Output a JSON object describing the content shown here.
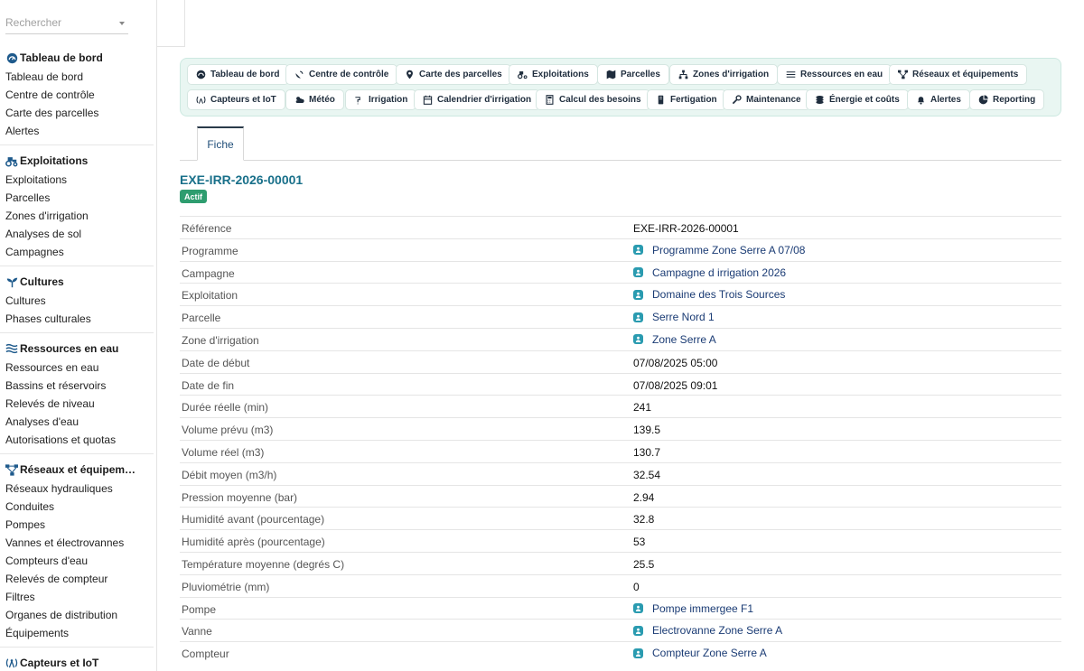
{
  "sidebar": {
    "search_placeholder": "Rechercher",
    "groups": [
      {
        "title": "Tableau de bord",
        "icon": "gauge-icon",
        "items": [
          "Tableau de bord",
          "Centre de contrôle",
          "Carte des parcelles",
          "Alertes"
        ]
      },
      {
        "title": "Exploitations",
        "icon": "tractor-icon",
        "items": [
          "Exploitations",
          "Parcelles",
          "Zones d'irrigation",
          "Analyses de sol",
          "Campagnes"
        ]
      },
      {
        "title": "Cultures",
        "icon": "seedling-icon",
        "items": [
          "Cultures",
          "Phases culturales"
        ]
      },
      {
        "title": "Ressources en eau",
        "icon": "water-icon",
        "items": [
          "Ressources en eau",
          "Bassins et réservoirs",
          "Relevés de niveau",
          "Analyses d'eau",
          "Autorisations et quotas"
        ]
      },
      {
        "title": "Réseaux et équipem…",
        "icon": "network-icon",
        "items": [
          "Réseaux hydrauliques",
          "Conduites",
          "Pompes",
          "Vannes et électrovannes",
          "Compteurs d'eau",
          "Relevés de compteur",
          "Filtres",
          "Organes de distribution",
          "Équipements"
        ]
      },
      {
        "title": "Capteurs et IoT",
        "icon": "antenna-icon",
        "items": []
      }
    ]
  },
  "toolbar": {
    "row1": [
      {
        "label": "Tableau de bord",
        "icon": "gauge-icon"
      },
      {
        "label": "Centre de contrôle",
        "icon": "satellite-dish-icon"
      },
      {
        "label": "Carte des parcelles",
        "icon": "map-marker-icon"
      },
      {
        "label": "Exploitations",
        "icon": "tractor-icon"
      },
      {
        "label": "Parcelles",
        "icon": "map-icon"
      },
      {
        "label": "Zones d'irrigation",
        "icon": "sitemap-icon"
      },
      {
        "label": "Ressources en eau",
        "icon": "water-icon"
      },
      {
        "label": "Réseaux et équipements",
        "icon": "network-icon"
      }
    ],
    "row2": [
      {
        "label": "Capteurs et IoT",
        "icon": "antenna-icon"
      },
      {
        "label": "Météo",
        "icon": "cloud-sun-icon"
      },
      {
        "label": "Irrigation",
        "icon": "faucet-icon"
      },
      {
        "label": "Calendrier d'irrigation",
        "icon": "calendar-icon"
      },
      {
        "label": "Calcul des besoins",
        "icon": "calculator-icon"
      },
      {
        "label": "Fertigation",
        "icon": "flask-icon"
      },
      {
        "label": "Maintenance",
        "icon": "wrench-icon"
      },
      {
        "label": "Énergie et coûts",
        "icon": "coins-icon"
      },
      {
        "label": "Alertes",
        "icon": "bell-icon"
      },
      {
        "label": "Reporting",
        "icon": "chart-pie-icon"
      }
    ]
  },
  "tabs": {
    "active": "Fiche"
  },
  "record": {
    "title": "EXE-IRR-2026-00001",
    "status": "Actif",
    "fields": [
      {
        "label": "Référence",
        "value": "EXE-IRR-2026-00001",
        "link": false
      },
      {
        "label": "Programme",
        "value": "Programme Zone Serre A 07/08",
        "link": true
      },
      {
        "label": "Campagne",
        "value": "Campagne d irrigation 2026",
        "link": true
      },
      {
        "label": "Exploitation",
        "value": "Domaine des Trois Sources",
        "link": true
      },
      {
        "label": "Parcelle",
        "value": "Serre Nord 1",
        "link": true
      },
      {
        "label": "Zone d'irrigation",
        "value": "Zone Serre A",
        "link": true
      },
      {
        "label": "Date de début",
        "value": "07/08/2025 05:00",
        "link": false
      },
      {
        "label": "Date de fin",
        "value": "07/08/2025 09:01",
        "link": false
      },
      {
        "label": "Durée réelle (min)",
        "value": "241",
        "link": false
      },
      {
        "label": "Volume prévu (m3)",
        "value": "139.5",
        "link": false
      },
      {
        "label": "Volume réel (m3)",
        "value": "130.7",
        "link": false
      },
      {
        "label": "Débit moyen (m3/h)",
        "value": "32.54",
        "link": false
      },
      {
        "label": "Pression moyenne (bar)",
        "value": "2.94",
        "link": false
      },
      {
        "label": "Humidité avant (pourcentage)",
        "value": "32.8",
        "link": false
      },
      {
        "label": "Humidité après (pourcentage)",
        "value": "53",
        "link": false
      },
      {
        "label": "Température moyenne (degrés C)",
        "value": "25.5",
        "link": false
      },
      {
        "label": "Pluviométrie (mm)",
        "value": "0",
        "link": false
      },
      {
        "label": "Pompe",
        "value": "Pompe immergee F1",
        "link": true
      },
      {
        "label": "Vanne",
        "value": "Electrovanne Zone Serre A",
        "link": true
      },
      {
        "label": "Compteur",
        "value": "Compteur Zone Serre A",
        "link": true
      }
    ]
  },
  "colors": {
    "accent": "#19708a",
    "status": "#2e9d6f",
    "toolbar_bg": "#e9f6f2",
    "link": "#1a3b74"
  }
}
